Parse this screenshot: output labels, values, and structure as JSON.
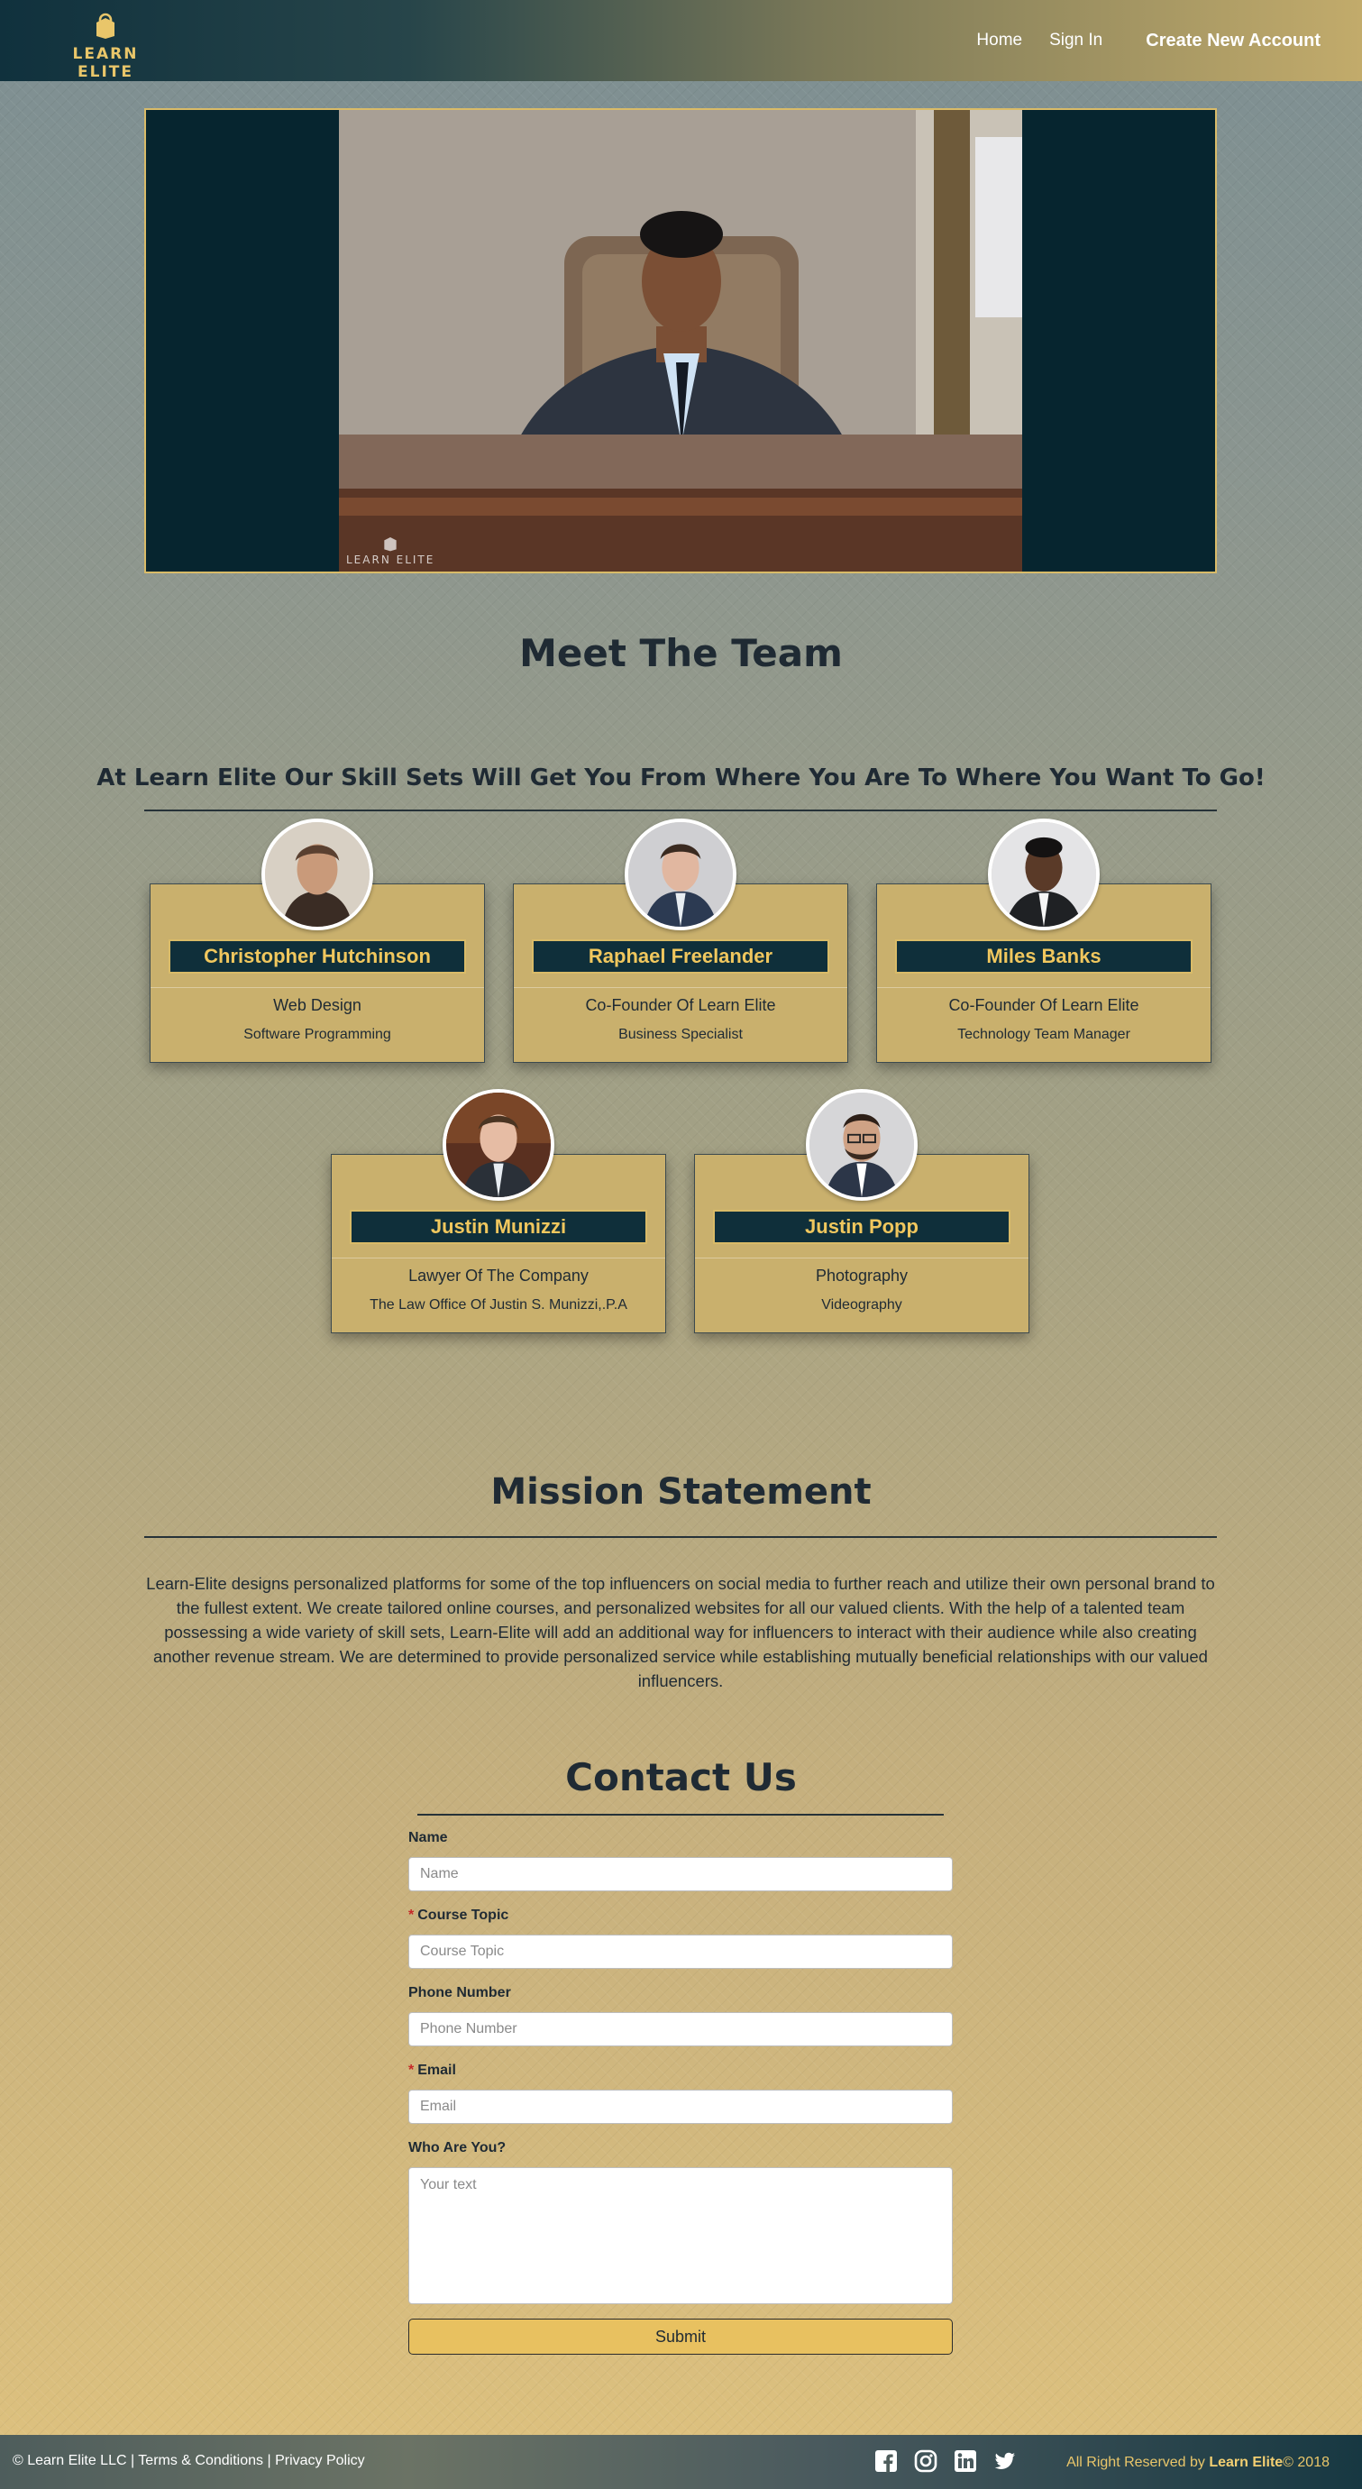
{
  "brand": {
    "name": "LEARN ELITE",
    "accent": "#e9c66a",
    "navy": "#0f2f3a"
  },
  "nav": {
    "home": "Home",
    "signin": "Sign In",
    "create": "Create New Account"
  },
  "video": {
    "watermark": "LEARN ELITE"
  },
  "team": {
    "title": "Meet The Team",
    "tagline": "At Learn Elite Our Skill Sets Will Get You From Where You Are To Where You Want To Go!",
    "members": [
      {
        "name": "Christopher Hutchinson",
        "role": "Web Design",
        "subrole": "Software Programming"
      },
      {
        "name": "Raphael Freelander",
        "role": "Co-Founder Of Learn Elite",
        "subrole": "Business Specialist"
      },
      {
        "name": "Miles Banks",
        "role": "Co-Founder Of Learn Elite",
        "subrole": "Technology Team Manager"
      },
      {
        "name": "Justin Munizzi",
        "role": "Lawyer Of The Company",
        "subrole": "The Law Office Of Justin S. Munizzi,.P.A"
      },
      {
        "name": "Justin Popp",
        "role": "Photography",
        "subrole": "Videography"
      }
    ]
  },
  "mission": {
    "title": "Mission Statement",
    "text": "Learn-Elite designs personalized platforms for some of the top influencers on social media to further reach and utilize their own personal brand to the fullest extent. We create tailored online courses, and personalized websites for all our valued clients. With the help of a talented team possessing a wide variety of skill sets, Learn-Elite will add an additional way for influencers to interact with their audience while also creating another revenue stream. We are determined to provide personalized service while establishing mutually beneficial relationships with our valued influencers."
  },
  "contact": {
    "title": "Contact Us",
    "fields": {
      "name": {
        "label": "Name",
        "placeholder": "Name"
      },
      "topic": {
        "required_mark": "*",
        "label": "Course Topic",
        "placeholder": "Course Topic"
      },
      "phone": {
        "label": "Phone Number",
        "placeholder": "Phone Number"
      },
      "email": {
        "required_mark": "*",
        "label": "Email",
        "placeholder": "Email"
      },
      "about": {
        "label": "Who Are You?",
        "placeholder": "Your text"
      }
    },
    "submit": "Submit"
  },
  "footer": {
    "copyright": "© Learn Elite LLC",
    "sep1": " | ",
    "terms": "Terms & Conditions",
    "sep2": " | ",
    "privacy": "Privacy Policy",
    "rights_prefix": "All Right Reserved by ",
    "rights_brand": "Learn Elite",
    "rights_suffix": "© 2018",
    "social": [
      "facebook-icon",
      "instagram-icon",
      "linkedin-icon",
      "twitter-icon"
    ]
  }
}
